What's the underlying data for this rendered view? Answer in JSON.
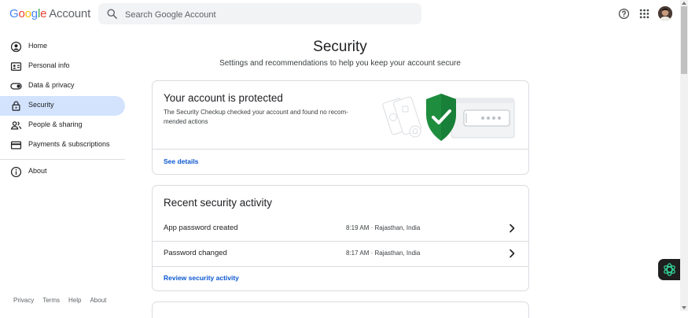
{
  "header": {
    "logo_google": "Google",
    "logo_account": "Account",
    "search_placeholder": "Search Google Account"
  },
  "sidebar": {
    "items": [
      {
        "label": "Home",
        "icon": "home-icon"
      },
      {
        "label": "Personal info",
        "icon": "id-card-icon"
      },
      {
        "label": "Data & privacy",
        "icon": "toggle-icon"
      },
      {
        "label": "Security",
        "icon": "lock-icon",
        "active": true
      },
      {
        "label": "People & sharing",
        "icon": "people-icon"
      },
      {
        "label": "Payments & subscriptions",
        "icon": "credit-card-icon"
      }
    ],
    "about": {
      "label": "About",
      "icon": "info-icon"
    },
    "footer": [
      "Privacy",
      "Terms",
      "Help",
      "About"
    ]
  },
  "main": {
    "title": "Security",
    "subtitle": "Settings and recommendations to help you keep your account secure",
    "protected_card": {
      "title": "Your account is protected",
      "description": "The Security Checkup checked your account and found no recom-mended actions",
      "link": "See details"
    },
    "activity_card": {
      "title": "Recent security activity",
      "rows": [
        {
          "name": "App password created",
          "detail": "8:19 AM · Rajasthan, India"
        },
        {
          "name": "Password changed",
          "detail": "8:17 AM · Rajasthan, India"
        }
      ],
      "link": "Review security activity"
    }
  },
  "colors": {
    "active_nav_bg": "#d3e3fd",
    "link": "#0b57d0",
    "shield_green": "#1e8e3e"
  }
}
